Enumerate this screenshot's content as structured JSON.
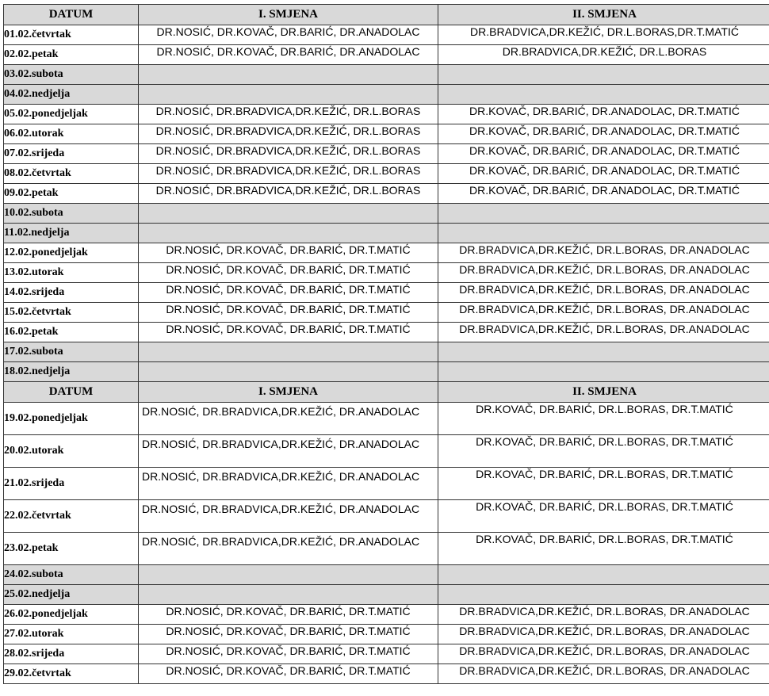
{
  "headers": {
    "date": "DATUM",
    "shift1": "I. SMJENA",
    "shift2": "II. SMJENA"
  },
  "rows": [
    {
      "date": "01.02.četvrtak",
      "s1": "DR.NOSIĆ, DR.KOVAČ, DR.BARIĆ, DR.ANADOLAC",
      "s2": "DR.BRADVICA,DR.KEŽIĆ, DR.L.BORAS,DR.T.MATIĆ"
    },
    {
      "date": "02.02.petak",
      "s1": "DR.NOSIĆ, DR.KOVAČ, DR.BARIĆ, DR.ANADOLAC",
      "s2": "DR.BRADVICA,DR.KEŽIĆ, DR.L.BORAS"
    },
    {
      "date": "03.02.subota",
      "s1": "",
      "s2": ""
    },
    {
      "date": "04.02.nedjelja",
      "s1": "",
      "s2": ""
    },
    {
      "date": "05.02.ponedjeljak",
      "s1": "DR.NOSIĆ, DR.BRADVICA,DR.KEŽIĆ, DR.L.BORAS",
      "s2": "DR.KOVAČ, DR.BARIĆ, DR.ANADOLAC, DR.T.MATIĆ"
    },
    {
      "date": "06.02.utorak",
      "s1": "DR.NOSIĆ, DR.BRADVICA,DR.KEŽIĆ, DR.L.BORAS",
      "s2": "DR.KOVAČ, DR.BARIĆ, DR.ANADOLAC, DR.T.MATIĆ"
    },
    {
      "date": "07.02.srijeda",
      "s1": "DR.NOSIĆ, DR.BRADVICA,DR.KEŽIĆ, DR.L.BORAS",
      "s2": "DR.KOVAČ, DR.BARIĆ, DR.ANADOLAC, DR.T.MATIĆ"
    },
    {
      "date": "08.02.četvrtak",
      "s1": "DR.NOSIĆ, DR.BRADVICA,DR.KEŽIĆ, DR.L.BORAS",
      "s2": "DR.KOVAČ, DR.BARIĆ, DR.ANADOLAC, DR.T.MATIĆ"
    },
    {
      "date": "09.02.petak",
      "s1": "DR.NOSIĆ, DR.BRADVICA,DR.KEŽIĆ, DR.L.BORAS",
      "s2": "DR.KOVAČ, DR.BARIĆ, DR.ANADOLAC, DR.T.MATIĆ"
    },
    {
      "date": "10.02.subota",
      "s1": "",
      "s2": ""
    },
    {
      "date": "11.02.nedjelja",
      "s1": "",
      "s2": ""
    },
    {
      "date": "12.02.ponedjeljak",
      "s1": "DR.NOSIĆ, DR.KOVAČ, DR.BARIĆ, DR.T.MATIĆ",
      "s2": "DR.BRADVICA,DR.KEŽIĆ, DR.L.BORAS, DR.ANADOLAC"
    },
    {
      "date": "13.02.utorak",
      "s1": "DR.NOSIĆ, DR.KOVAČ, DR.BARIĆ, DR.T.MATIĆ",
      "s2": "DR.BRADVICA,DR.KEŽIĆ, DR.L.BORAS, DR.ANADOLAC"
    },
    {
      "date": "14.02.srijeda",
      "s1": "DR.NOSIĆ, DR.KOVAČ, DR.BARIĆ, DR.T.MATIĆ",
      "s2": "DR.BRADVICA,DR.KEŽIĆ, DR.L.BORAS, DR.ANADOLAC"
    },
    {
      "date": "15.02.četvrtak",
      "s1": "DR.NOSIĆ, DR.KOVAČ, DR.BARIĆ, DR.T.MATIĆ",
      "s2": "DR.BRADVICA,DR.KEŽIĆ, DR.L.BORAS, DR.ANADOLAC"
    },
    {
      "date": "16.02.petak",
      "s1": "DR.NOSIĆ, DR.KOVAČ, DR.BARIĆ, DR.T.MATIĆ",
      "s2": "DR.BRADVICA,DR.KEŽIĆ, DR.L.BORAS, DR.ANADOLAC"
    },
    {
      "date": "17.02.subota",
      "s1": "",
      "s2": ""
    },
    {
      "date": "18.02.nedjelja",
      "s1": "",
      "s2": ""
    },
    {
      "date": "19.02.ponedjeljak",
      "s1": "DR.NOSIĆ, DR.BRADVICA,DR.KEŽIĆ, DR.ANADOLAC",
      "s2": "DR.KOVAČ, DR.BARIĆ, DR.L.BORAS, DR.T.MATIĆ"
    },
    {
      "date": "20.02.utorak",
      "s1": "DR.NOSIĆ, DR.BRADVICA,DR.KEŽIĆ, DR.ANADOLAC",
      "s2": "DR.KOVAČ, DR.BARIĆ, DR.L.BORAS, DR.T.MATIĆ"
    },
    {
      "date": "21.02.srijeda",
      "s1": "DR.NOSIĆ, DR.BRADVICA,DR.KEŽIĆ, DR.ANADOLAC",
      "s2": "DR.KOVAČ, DR.BARIĆ, DR.L.BORAS, DR.T.MATIĆ"
    },
    {
      "date": "22.02.četvrtak",
      "s1": "DR.NOSIĆ, DR.BRADVICA,DR.KEŽIĆ, DR.ANADOLAC",
      "s2": "DR.KOVAČ, DR.BARIĆ, DR.L.BORAS, DR.T.MATIĆ"
    },
    {
      "date": "23.02.petak",
      "s1": "DR.NOSIĆ, DR.BRADVICA,DR.KEŽIĆ, DR.ANADOLAC",
      "s2": "DR.KOVAČ, DR.BARIĆ, DR.L.BORAS, DR.T.MATIĆ"
    },
    {
      "date": "24.02.subota",
      "s1": "",
      "s2": ""
    },
    {
      "date": "25.02.nedjelja",
      "s1": "",
      "s2": ""
    },
    {
      "date": "26.02.ponedjeljak",
      "s1": "DR.NOSIĆ, DR.KOVAČ, DR.BARIĆ, DR.T.MATIĆ",
      "s2": "DR.BRADVICA,DR.KEŽIĆ, DR.L.BORAS, DR.ANADOLAC"
    },
    {
      "date": "27.02.utorak",
      "s1": "DR.NOSIĆ, DR.KOVAČ, DR.BARIĆ, DR.T.MATIĆ",
      "s2": "DR.BRADVICA,DR.KEŽIĆ, DR.L.BORAS, DR.ANADOLAC"
    },
    {
      "date": "28.02.srijeda",
      "s1": "DR.NOSIĆ, DR.KOVAČ, DR.BARIĆ, DR.T.MATIĆ",
      "s2": "DR.BRADVICA,DR.KEŽIĆ, DR.L.BORAS, DR.ANADOLAC"
    },
    {
      "date": "29.02.četvrtak",
      "s1": "DR.NOSIĆ, DR.KOVAČ, DR.BARIĆ, DR.T.MATIĆ",
      "s2": "DR.BRADVICA,DR.KEŽIĆ, DR.L.BORAS, DR.ANADOLAC"
    }
  ]
}
